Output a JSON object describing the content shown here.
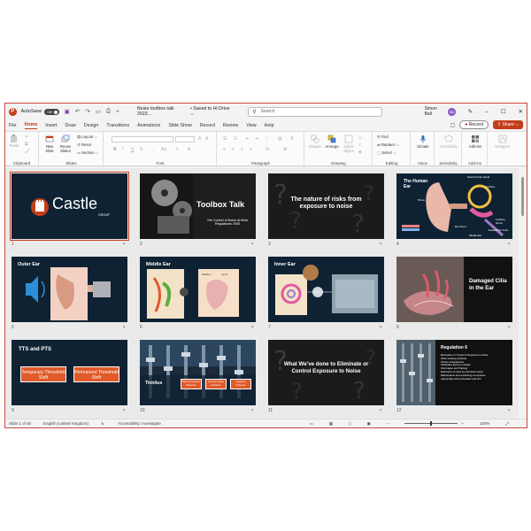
{
  "titlebar": {
    "autosave_label": "AutoSave",
    "autosave_state": "Off",
    "doc_title": "Noise toolbox talk 2023...",
    "save_status": "• Saved to Hi Drive ⌵",
    "search_placeholder": "Search",
    "user_name": "Simon Ball",
    "user_initials": "SB"
  },
  "tabs": [
    "File",
    "Home",
    "Insert",
    "Draw",
    "Design",
    "Transitions",
    "Animations",
    "Slide Show",
    "Record",
    "Review",
    "View",
    "Help"
  ],
  "active_tab": "Home",
  "record_label": "Record",
  "share_label": "Share",
  "ribbon": {
    "groups": [
      "Clipboard",
      "Slides",
      "Font",
      "Paragraph",
      "Drawing",
      "Editing",
      "Voice",
      "Sensitivity",
      "Add-ins"
    ],
    "buttons": {
      "paste": "Paste",
      "new_slide": "New Slide",
      "reuse_slides": "Reuse Slides",
      "layout": "Layout ⌵",
      "reset": "Reset",
      "section": "Section ⌵",
      "shapes": "Shapes",
      "arrange": "Arrange",
      "quick_styles": "Quick Styles",
      "find": "Find",
      "replace": "Replace ⌵",
      "select": "Select ⌵",
      "dictate": "Dictate",
      "sensitivity": "Sensitivity",
      "add_ins": "Add-ins",
      "designer": "Designer"
    }
  },
  "slides": [
    {
      "num": "1",
      "title": "Castle",
      "subtitle": "GROUP",
      "selected": true
    },
    {
      "num": "2",
      "title": "Toolbox Talk",
      "subtitle": "The Control of Noise at Work Regulations 2005"
    },
    {
      "num": "3",
      "title": "The nature of risks from exposure to noise"
    },
    {
      "num": "4",
      "title": "The Human Ear",
      "labels": [
        "Semicircular Canal",
        "Cochlea",
        "Auditory Nerve",
        "Ear Drum",
        "Middle Ear",
        "Eustachian Tube",
        "Pinna"
      ]
    },
    {
      "num": "5",
      "title": "Outer Ear"
    },
    {
      "num": "6",
      "title": "Middle Ear",
      "labels": [
        "Malleus",
        "Incus"
      ]
    },
    {
      "num": "7",
      "title": "Inner Ear"
    },
    {
      "num": "8",
      "title": "Damaged Cilia in the Ear"
    },
    {
      "num": "9",
      "title": "TTS and PTS",
      "boxes": [
        "Temporary Threshold Shift",
        "Permanent Threshold Shift"
      ]
    },
    {
      "num": "10",
      "title": "Tinnitus",
      "boxes": [
        "Sound Distress Stimulus",
        "Can be Noise Induced",
        "Ongoing Induced"
      ]
    },
    {
      "num": "11",
      "title": "What We've done to Eliminate or Control Exposure to Noise"
    },
    {
      "num": "12",
      "title": "Regulation 6",
      "bullets": [
        "Elimination or Control of Exposure to Noise",
        "Other working methods",
        "Choice of Equipment",
        "Workplace layout or design",
        "Information and Training",
        "Reduction of noise by technical means",
        "Maintenance and monitoring of exposure",
        "Appropriate work schedules and rest"
      ]
    }
  ],
  "status": {
    "slide_count": "Slide 1 of 48",
    "language": "English (United Kingdom)",
    "accessibility": "Accessibility: Investigate",
    "zoom": "100%"
  },
  "colors": {
    "accent": "#c43e1c",
    "slide_bg": "#0f2233",
    "orange": "#e05a2a"
  }
}
